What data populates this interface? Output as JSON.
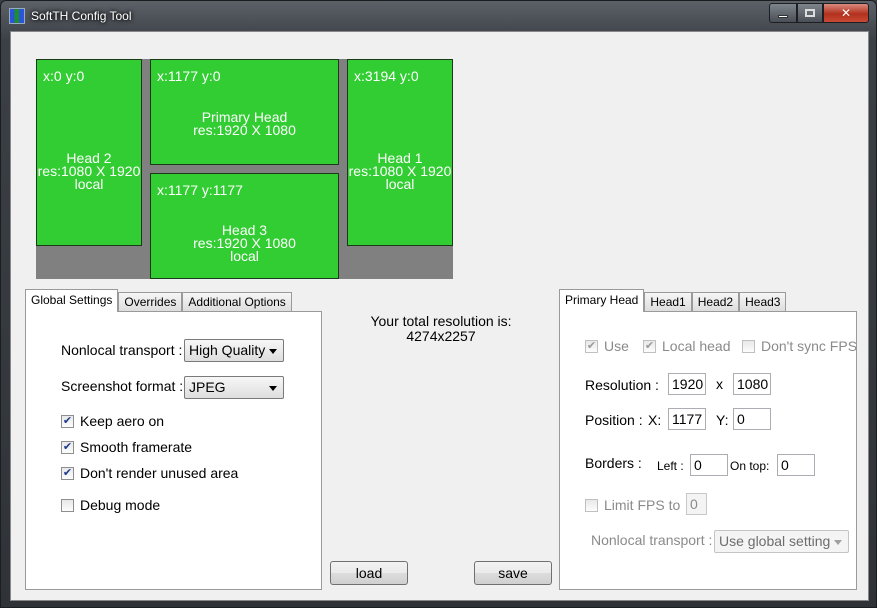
{
  "window": {
    "title": "SoftTH Config Tool",
    "minimize_icon": "minimize-icon",
    "maximize_icon": "maximize-icon",
    "close_icon": "close-icon"
  },
  "preview": {
    "heads": [
      {
        "id": "head2",
        "coord": "x:0 y:0",
        "name": "Head 2",
        "res": "res:1080 X 1920",
        "type": "local"
      },
      {
        "id": "primary",
        "coord": "x:1177 y:0",
        "name": "Primary Head",
        "res": "res:1920 X 1080",
        "type": ""
      },
      {
        "id": "head1",
        "coord": "x:3194 y:0",
        "name": "Head 1",
        "res": "res:1080 X 1920",
        "type": "local"
      },
      {
        "id": "head3",
        "coord": "x:1177 y:1177",
        "name": "Head 3",
        "res": "res:1920 X 1080",
        "type": "local"
      }
    ]
  },
  "left_tabs": [
    "Global Settings",
    "Overrides",
    "Additional Options"
  ],
  "global": {
    "nonlocal_label": "Nonlocal transport :",
    "nonlocal_value": "High Quality",
    "screenshot_label": "Screenshot format :",
    "screenshot_value": "JPEG",
    "keep_aero": {
      "label": "Keep aero on",
      "checked": true
    },
    "smooth": {
      "label": "Smooth framerate",
      "checked": true
    },
    "dont_render": {
      "label": "Don't render unused area",
      "checked": true
    },
    "debug": {
      "label": "Debug mode",
      "checked": false
    }
  },
  "total": {
    "label": "Your total resolution is:",
    "value": "4274x2257"
  },
  "buttons": {
    "load": "load",
    "save": "save"
  },
  "right_tabs": [
    "Primary Head",
    "Head1",
    "Head2",
    "Head3"
  ],
  "head": {
    "use": "Use",
    "local_head": "Local head",
    "dont_sync": "Don't sync FPS",
    "resolution_label": "Resolution :",
    "res_w": "1920",
    "res_x": "x",
    "res_h": "1080",
    "position_label": "Position :",
    "pos_x_label": "X:",
    "pos_x": "1177",
    "pos_y_label": "Y:",
    "pos_y": "0",
    "borders_label": "Borders :",
    "left_label": "Left :",
    "left_value": "0",
    "ontop_label": "On top:",
    "ontop_value": "0",
    "limit_fps": "Limit FPS to",
    "limit_value": "0",
    "nonlocal_label": "Nonlocal transport :",
    "nonlocal_value": "Use global setting"
  },
  "colors": {
    "head_fill": "#32cd32",
    "preview_bg": "#808080"
  }
}
